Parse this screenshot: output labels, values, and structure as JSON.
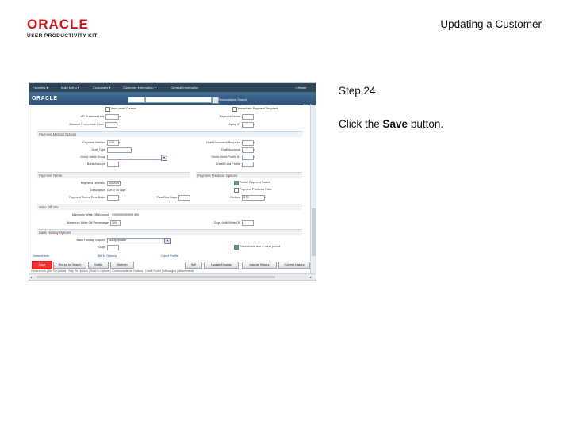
{
  "header": {
    "logo_brand": "ORACLE",
    "logo_tagline": "USER PRODUCTIVITY KIT",
    "slide_title": "Updating a Customer"
  },
  "step": {
    "label": "Step 24"
  },
  "instruction": {
    "prefix": "Click the ",
    "action": "Save",
    "suffix": " button."
  },
  "app": {
    "menubar": [
      "Favorites ▾",
      "Main Menu ▾",
      "Customers ▾",
      "Customer Information ▾",
      "General Information"
    ],
    "home": "⌂ Home",
    "add_to": "Add To",
    "navbar_link": "NavBar",
    "brand": "ORACLE",
    "search_scope": "All",
    "search_value": "Search",
    "personalized": "Personalized Search",
    "fields_top": {
      "item_level": "Item Level Contact",
      "immediate": "Immediate Payment Required",
      "ar_business_unit": "AR Business Unit",
      "past_due_date": "Payment Terms",
      "balance_pref": "Balance Preference Code",
      "aging_id": "Aging ID"
    },
    "section_payment_method": "Payment Method Options",
    "pm": {
      "payment_method": "Payment Method",
      "payment_method_val": "CHK",
      "draft_type": "Draft Type",
      "direct_debit": "Direct Debit Group",
      "bank_account": "Bank Account",
      "draft_document": "Draft Document Required",
      "draft_approval": "Draft Approval",
      "direct_debit_profile": "Direct Debit Profile ID",
      "credit_card_profile": "Credit Card Profile"
    },
    "section_payment_terms": "Payment Terms",
    "pt": {
      "payment_terms_id": "Payment Terms ID",
      "payment_terms_val": "30DAYS",
      "description": "Description",
      "description_val": "Due in 30 days",
      "payment_terms_time": "Payment Terms Time Basis",
      "past_due_days": "Past Due Days"
    },
    "section_payment_predictor": "Payment Predictor Options",
    "pp": {
      "partial_payment": "Partial Payment Switch",
      "payment_predictor": "Payment Predictor Field",
      "method": "Method",
      "method_val": "STD"
    },
    "section_writeoff": "Write Off Info",
    "wo": {
      "max_writeoff": "Maximum Write Off Amount",
      "max_writeoff_val": "99999999999999.999",
      "max_writeoff_pct": "Maximum Write Off Percentage",
      "max_writeoff_pct_val": "100",
      "days_until_writeoff": "Days Until Write Off"
    },
    "section_bank": "Bank Holiday Options",
    "bh": {
      "bank_holiday": "Bank Holiday Options",
      "bank_holiday_val": "Not Applicable",
      "days": "Days",
      "reschedule": "Reschedule due in next period"
    },
    "links": {
      "general_info": "General Info",
      "bill_to": "Bill To Options",
      "credit_profile": "Credit Profile"
    },
    "buttons": {
      "save": "Save",
      "return_search": "Return to Search",
      "notify": "Notify",
      "refresh": "Refresh",
      "self": "Self",
      "update_display": "Update/Display",
      "include_history": "Include History",
      "correct_history": "Correct History"
    },
    "footer_text": "General Info | Bill To Options | Ship To Options | Sold To Options | Correspondence Options | Credit Profile | Messages | Attachments"
  },
  "colors": {
    "oracle_red": "#d01818",
    "brandbar": "#2e5276",
    "menubar": "#2f4558",
    "highlight": "#e81c1c"
  }
}
